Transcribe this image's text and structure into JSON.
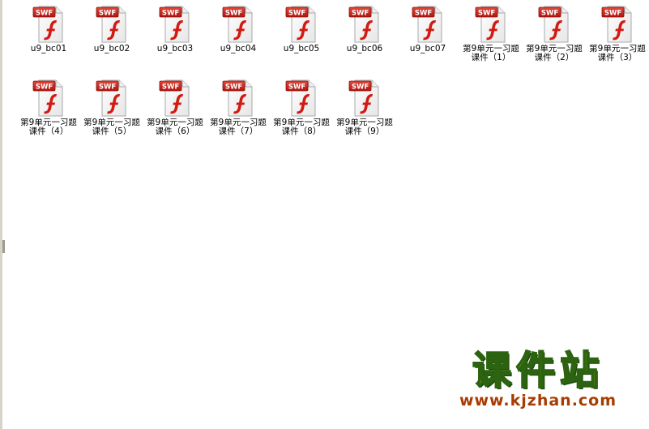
{
  "icon_type": "swf-file-icon",
  "icon_badge": "SWF",
  "files": [
    {
      "name": "u9_bc01"
    },
    {
      "name": "u9_bc02"
    },
    {
      "name": "u9_bc03"
    },
    {
      "name": "u9_bc04"
    },
    {
      "name": "u9_bc05"
    },
    {
      "name": "u9_bc06"
    },
    {
      "name": "u9_bc07"
    },
    {
      "name": "第9单元一习题课件（1）"
    },
    {
      "name": "第9单元一习题课件（2）"
    },
    {
      "name": "第9单元一习题课件（3）"
    },
    {
      "name": "第9单元一习题课件（4）"
    },
    {
      "name": "第9单元一习题课件（5）"
    },
    {
      "name": "第9单元一习题课件（6）"
    },
    {
      "name": "第9单元一习题课件（7）"
    },
    {
      "name": "第9单元一习题课件（8）"
    },
    {
      "name": "第9单元一习题课件（9）"
    }
  ],
  "watermark": {
    "title": "课件站",
    "url": "www.kjzhan.com"
  },
  "colors": {
    "badge_red": "#c8201c",
    "flash_red": "#d21a12",
    "watermark_yellow": "#e9d200",
    "watermark_green": "#2b6310",
    "watermark_url": "#a83b00"
  }
}
